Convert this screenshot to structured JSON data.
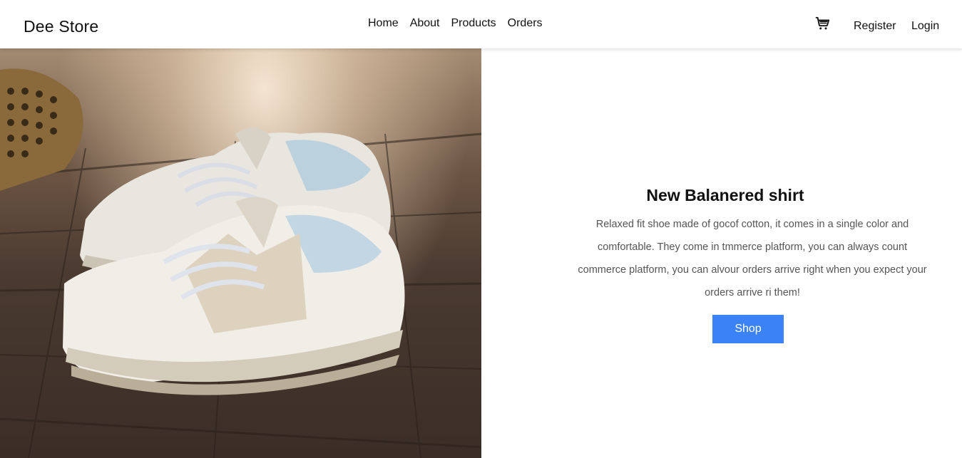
{
  "brand": {
    "name": "Dee Store"
  },
  "nav": {
    "links": [
      {
        "label": "Home"
      },
      {
        "label": "About"
      },
      {
        "label": "Products"
      },
      {
        "label": "Orders"
      }
    ],
    "cart_icon": "shopping-cart-icon",
    "register_label": "Register",
    "login_label": "Login"
  },
  "hero": {
    "image_alt": "White sneakers on a wooden table",
    "title": "New Balanered shirt",
    "description": "Relaxed fit shoe made of gocof cotton, it comes in a single color and comfortable. They come in tmmerce platform, you can always count commerce platform, you can alvour orders arrive right when you expect your orders arrive ri  them!",
    "button_label": "Shop"
  },
  "colors": {
    "accent": "#3b82f6",
    "text": "#111111",
    "muted_text": "#555555"
  }
}
